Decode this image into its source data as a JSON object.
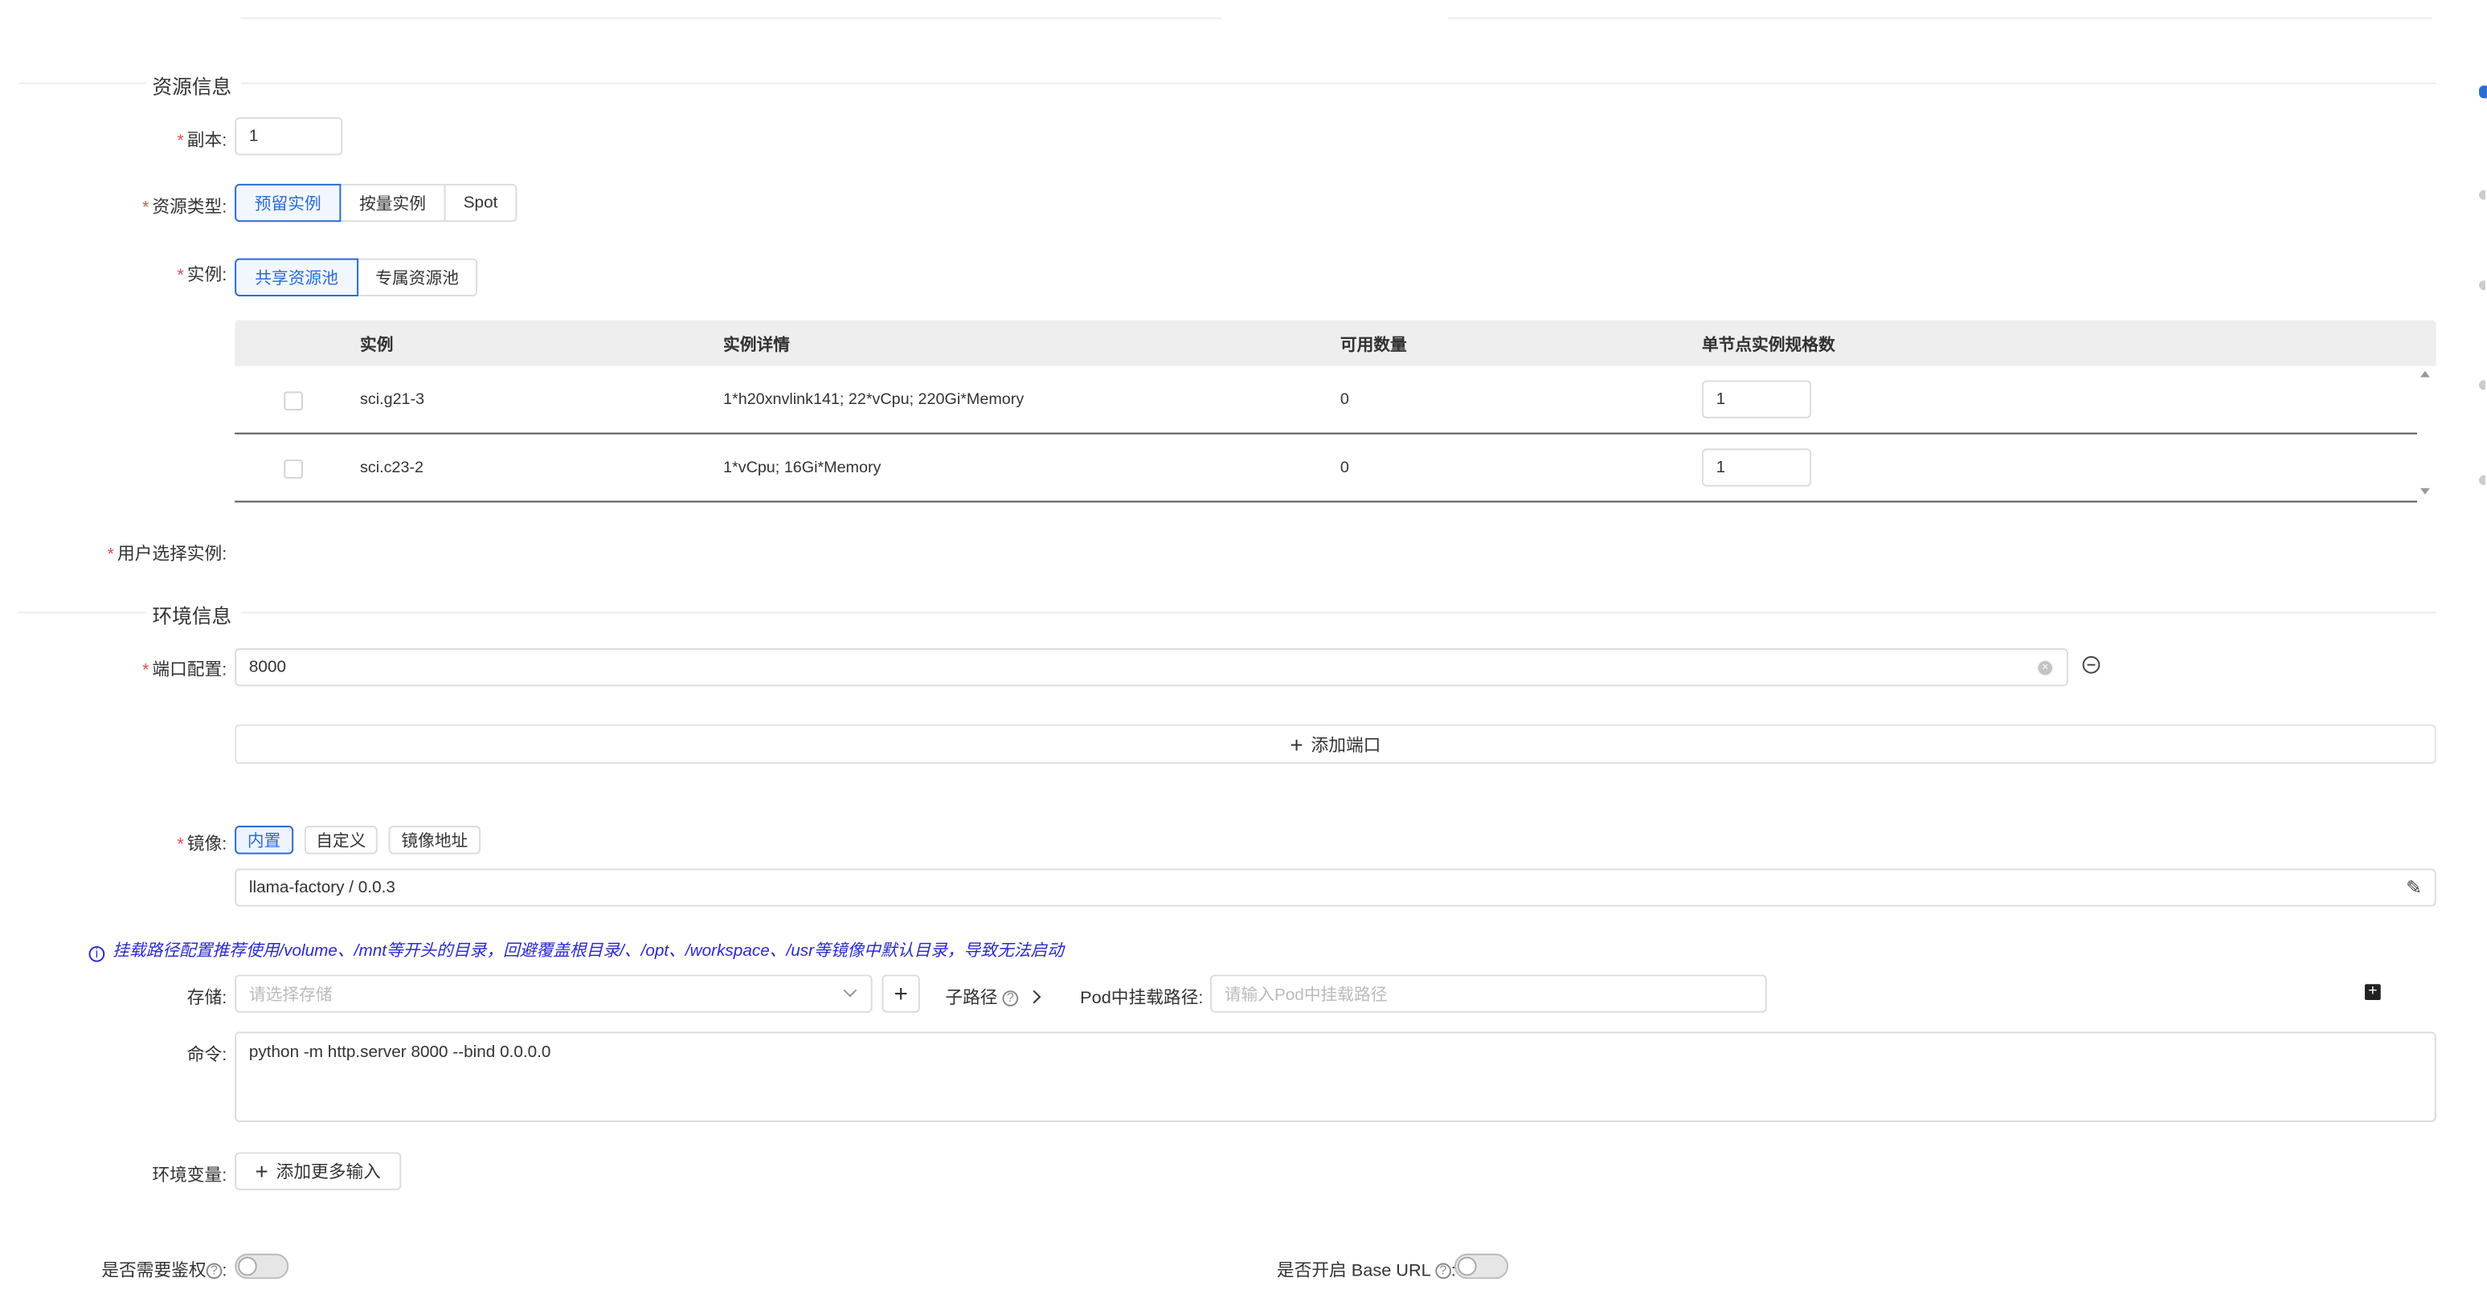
{
  "sections": {
    "resource_title": "资源信息",
    "env_title": "环境信息"
  },
  "replica": {
    "label": "副本:",
    "value": "1"
  },
  "resource_type": {
    "label": "资源类型:",
    "options": [
      "预留实例",
      "按量实例",
      "Spot"
    ],
    "selected": "预留实例"
  },
  "instance": {
    "label": "实例:",
    "options": [
      "共享资源池",
      "专属资源池"
    ],
    "selected": "共享资源池"
  },
  "table": {
    "headers": [
      "实例",
      "实例详情",
      "可用数量",
      "单节点实例规格数"
    ],
    "rows": [
      {
        "name": "sci.g21-3",
        "detail": "1*h20xnvlink141; 22*vCpu; 220Gi*Memory",
        "available": "0",
        "spec_count": "1"
      },
      {
        "name": "sci.c23-2",
        "detail": "1*vCpu; 16Gi*Memory",
        "available": "0",
        "spec_count": "1"
      }
    ]
  },
  "user_instance": {
    "label": "用户选择实例:"
  },
  "port": {
    "label": "端口配置:",
    "value": "8000",
    "add_label": "添加端口"
  },
  "image": {
    "label": "镜像:",
    "options": [
      "内置",
      "自定义",
      "镜像地址"
    ],
    "selected": "内置",
    "value": "llama-factory / 0.0.3"
  },
  "mount_tip": "挂载路径配置推荐使用/volume、/mnt等开头的目录，回避覆盖根目录/、/opt、/workspace、/usr等镜像中默认目录，导致无法启动",
  "storage": {
    "label": "存储:",
    "placeholder": "请选择存储",
    "subpath_label": "子路径",
    "pod_path_label": "Pod中挂载路径:",
    "pod_path_placeholder": "请输入Pod中挂载路径"
  },
  "command": {
    "label": "命令:",
    "value": "python -m http.server 8000 --bind 0.0.0.0"
  },
  "env_vars": {
    "label": "环境变量:",
    "add_label": "添加更多输入"
  },
  "auth": {
    "label": "是否需要鉴权"
  },
  "base_url": {
    "label": "是否开启 Base URL"
  },
  "colors": {
    "accent": "#2b6bd6",
    "required": "#e34d59",
    "tip": "#2a2acb"
  }
}
